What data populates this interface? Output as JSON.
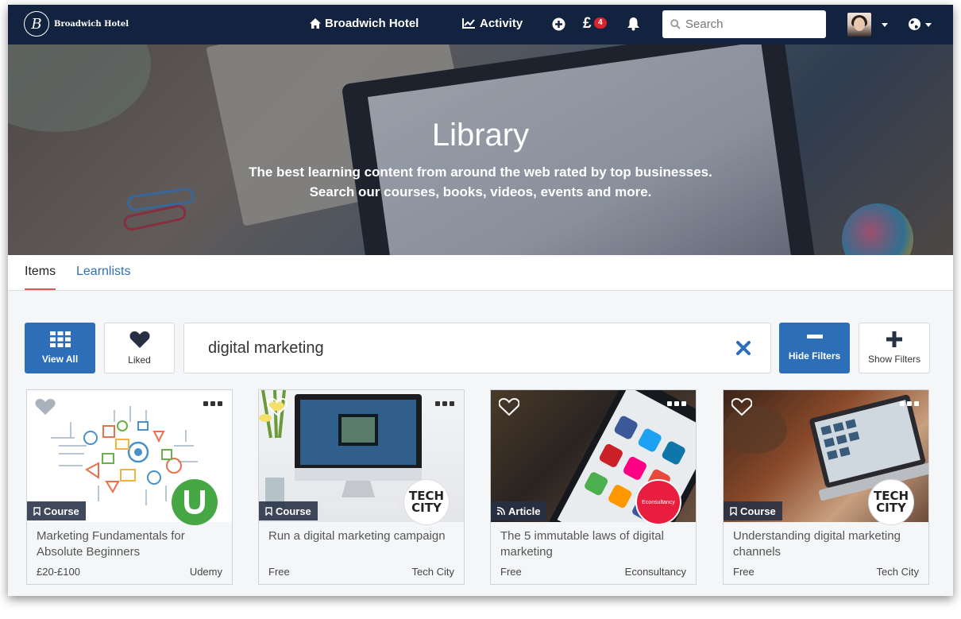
{
  "navbar": {
    "brand_initial": "B",
    "brand_name": "Broadwich Hotel",
    "home_label": "Broadwich Hotel",
    "activity_label": "Activity",
    "currency_symbol": "£",
    "currency_badge": "4",
    "search_placeholder": "Search",
    "icons": [
      "home-icon",
      "activity-chart-icon",
      "plus-circle-icon",
      "bell-icon",
      "search-icon",
      "globe-icon",
      "caret-down-icon"
    ]
  },
  "hero": {
    "title": "Library",
    "subtitle_line1": "The best learning content from around the web rated by top businesses.",
    "subtitle_line2": "Search our courses, books, videos, events and more."
  },
  "tabs": [
    {
      "label": "Items",
      "active": true
    },
    {
      "label": "Learnlists",
      "active": false
    }
  ],
  "filters": {
    "view_all_label": "View All",
    "liked_label": "Liked",
    "search_query": "digital marketing",
    "hide_filters_label": "Hide Filters",
    "show_filters_label": "Show Filters"
  },
  "cards": [
    {
      "type": "Course",
      "title": "Marketing Fundamentals for Absolute Beginners",
      "price": "£20-£100",
      "provider": "Udemy",
      "provider_logo": "U"
    },
    {
      "type": "Course",
      "title": "Run a digital marketing campaign",
      "price": "Free",
      "provider": "Tech City",
      "provider_logo": "TECH CITY"
    },
    {
      "type": "Article",
      "title": "The 5 immutable laws of digital marketing",
      "price": "Free",
      "provider": "Econsultancy",
      "provider_logo": "Econsultancy"
    },
    {
      "type": "Course",
      "title": "Understanding digital marketing channels",
      "price": "Free",
      "provider": "Tech City",
      "provider_logo": "TECH CITY"
    }
  ],
  "colors": {
    "navbar": "#12233f",
    "primary": "#2c6eb7",
    "tab_underline": "#e0574b",
    "badge": "#d9232d",
    "udemy": "#46a844",
    "econsultancy": "#e81d3f"
  }
}
